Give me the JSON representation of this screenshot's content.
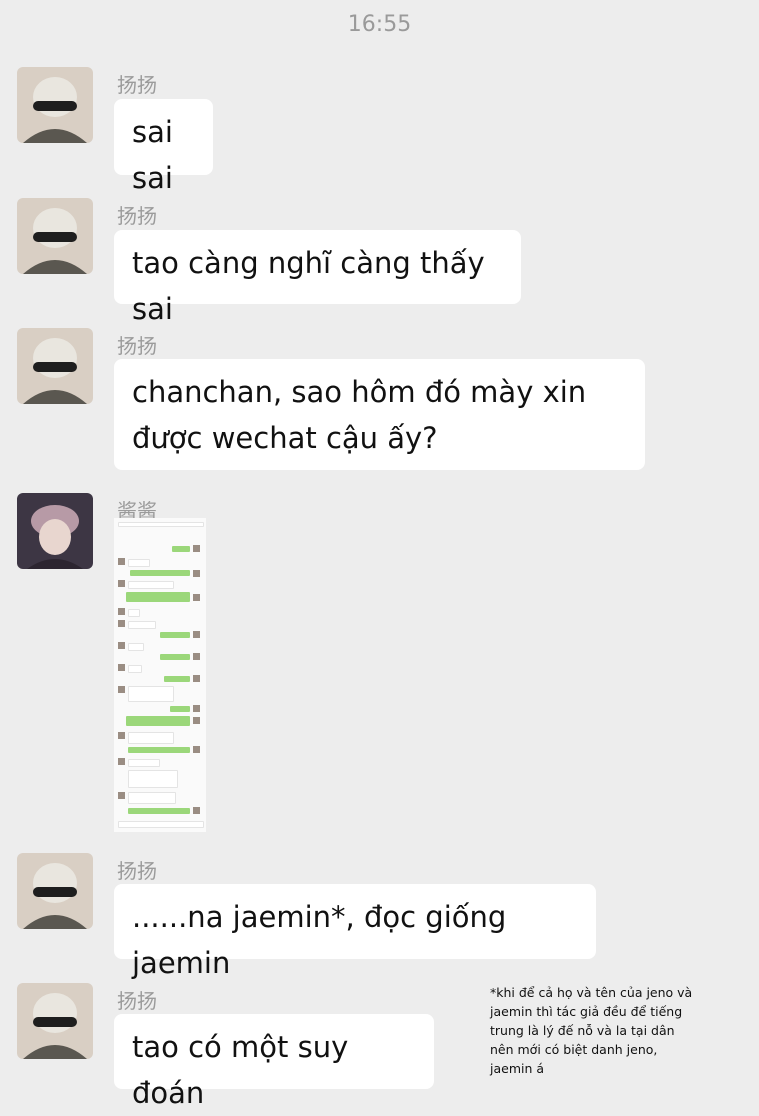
{
  "status": {
    "time": "16:55"
  },
  "messages": [
    {
      "sender": "扬扬",
      "text": "sai sai"
    },
    {
      "sender": "扬扬",
      "text": "tao càng nghĩ càng thấy sai"
    },
    {
      "sender": "扬扬",
      "text": "chanchan, sao hôm đó mày xin được wechat cậu ấy?"
    },
    {
      "sender": "酱酱",
      "text": ""
    },
    {
      "sender": "扬扬",
      "text": "......na jaemin*, đọc giống jaemin"
    },
    {
      "sender": "扬扬",
      "text": "tao có một suy đoán"
    }
  ],
  "footnote": "*khi để cả họ và tên của jeno và jaemin thì tác giả đều để tiếng trung là lý đế nỗ và la tại dân nên mới có biệt danh jeno, jaemin á",
  "colors": {
    "background": "#ededed",
    "bubble": "#ffffff",
    "sender": "#9b9b9b"
  }
}
